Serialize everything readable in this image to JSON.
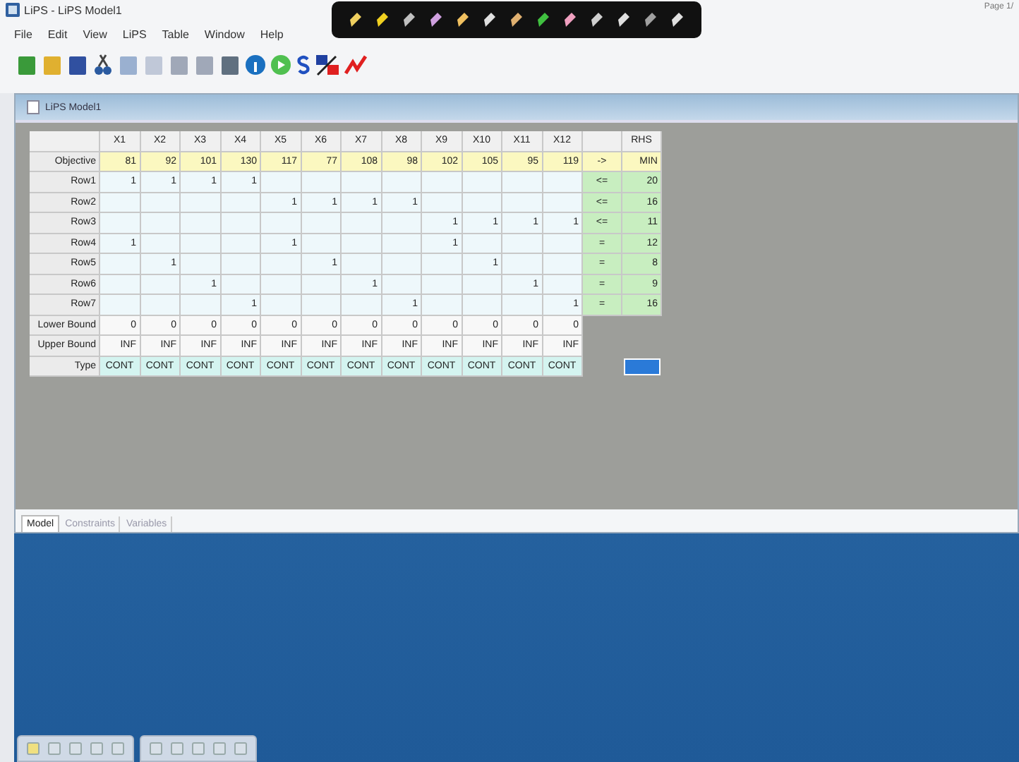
{
  "window": {
    "title": "LiPS - LiPS Model1"
  },
  "page_indicator": "Page 1/",
  "menu": [
    "File",
    "Edit",
    "View",
    "LiPS",
    "Table",
    "Window",
    "Help"
  ],
  "child_window": {
    "title": "LiPS Model1"
  },
  "table": {
    "columns": [
      "X1",
      "X2",
      "X3",
      "X4",
      "X5",
      "X6",
      "X7",
      "X8",
      "X9",
      "X10",
      "X11",
      "X12"
    ],
    "rhs_header": "RHS",
    "objective": {
      "label": "Objective",
      "values": [
        "81",
        "92",
        "101",
        "130",
        "117",
        "77",
        "108",
        "98",
        "102",
        "105",
        "95",
        "119"
      ],
      "op": "->",
      "rhs": "MIN"
    },
    "rows": [
      {
        "label": "Row1",
        "cells": [
          "1",
          "1",
          "1",
          "1",
          null,
          null,
          null,
          null,
          null,
          null,
          null,
          null
        ],
        "op": "<=",
        "rhs": "20"
      },
      {
        "label": "Row2",
        "cells": [
          null,
          null,
          null,
          null,
          "1",
          "1",
          "1",
          "1",
          null,
          null,
          null,
          null
        ],
        "op": "<=",
        "rhs": "16"
      },
      {
        "label": "Row3",
        "cells": [
          null,
          null,
          null,
          null,
          null,
          null,
          null,
          null,
          "1",
          "1",
          "1",
          "1"
        ],
        "op": "<=",
        "rhs": "11"
      },
      {
        "label": "Row4",
        "cells": [
          "1",
          null,
          null,
          null,
          "1",
          null,
          null,
          null,
          "1",
          null,
          null,
          null
        ],
        "op": "=",
        "rhs": "12"
      },
      {
        "label": "Row5",
        "cells": [
          null,
          "1",
          null,
          null,
          null,
          "1",
          null,
          null,
          null,
          "1",
          null,
          null
        ],
        "op": "=",
        "rhs": "8"
      },
      {
        "label": "Row6",
        "cells": [
          null,
          null,
          "1",
          null,
          null,
          null,
          "1",
          null,
          null,
          null,
          "1",
          null
        ],
        "op": "=",
        "rhs": "9"
      },
      {
        "label": "Row7",
        "cells": [
          null,
          null,
          null,
          "1",
          null,
          null,
          null,
          "1",
          null,
          null,
          null,
          "1"
        ],
        "op": "=",
        "rhs": "16"
      }
    ],
    "lower_bound": {
      "label": "Lower Bound",
      "values": [
        "0",
        "0",
        "0",
        "0",
        "0",
        "0",
        "0",
        "0",
        "0",
        "0",
        "0",
        "0"
      ]
    },
    "upper_bound": {
      "label": "Upper Bound",
      "values": [
        "INF",
        "INF",
        "INF",
        "INF",
        "INF",
        "INF",
        "INF",
        "INF",
        "INF",
        "INF",
        "INF",
        "INF"
      ]
    },
    "type": {
      "label": "Type",
      "values": [
        "CONT",
        "CONT",
        "CONT",
        "CONT",
        "CONT",
        "CONT",
        "CONT",
        "CONT",
        "CONT",
        "CONT",
        "CONT",
        "CONT"
      ],
      "rhs_selected": true
    }
  },
  "tabs": [
    {
      "label": "Model",
      "selected": true
    },
    {
      "label": "Constraints",
      "selected": false
    },
    {
      "label": "Variables",
      "selected": false
    }
  ]
}
